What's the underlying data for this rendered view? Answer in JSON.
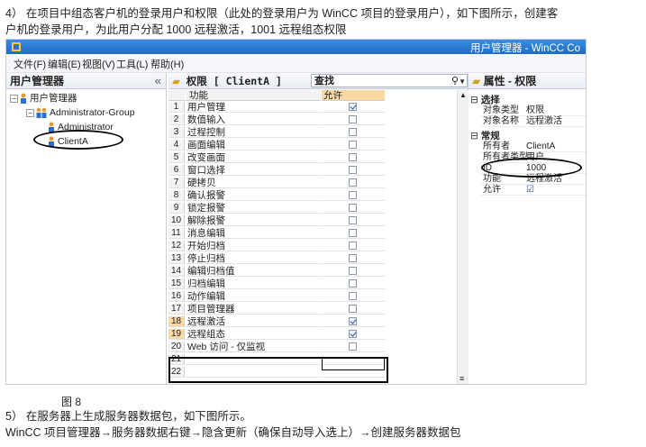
{
  "intro_line1": "4） 在项目中组态客户机的登录用户和权限（此处的登录用户为 WinCC 项目的登录用户），如下图所示，创建客",
  "intro_line2": "户机的登录用户，为此用户分配 1000 远程激活，1001 远程组态权限",
  "window": {
    "title": "用户管理器 - WinCC Co",
    "menu": [
      "文件(F)",
      "编辑(E)",
      "视图(V)",
      "工具(L)",
      "帮助(H)"
    ]
  },
  "left_pane": {
    "title": "用户管理器",
    "collapse_glyph": "«",
    "tree": {
      "root": "用户管理器",
      "group": "Administrator-Group",
      "users": [
        "Administrator",
        "ClientA"
      ]
    }
  },
  "middle_pane": {
    "title": "权限 [ ClientA ]",
    "search_placeholder": "查找",
    "columns": {
      "function": "功能",
      "allow": "允许"
    },
    "rows": [
      {
        "n": "1",
        "func": "用户管理",
        "checked": true
      },
      {
        "n": "2",
        "func": "数值输入",
        "checked": false
      },
      {
        "n": "3",
        "func": "过程控制",
        "checked": false
      },
      {
        "n": "4",
        "func": "画面编辑",
        "checked": false
      },
      {
        "n": "5",
        "func": "改变画面",
        "checked": false
      },
      {
        "n": "6",
        "func": "窗口选择",
        "checked": false
      },
      {
        "n": "7",
        "func": "硬拷贝",
        "checked": false
      },
      {
        "n": "8",
        "func": "确认报警",
        "checked": false
      },
      {
        "n": "9",
        "func": "锁定报警",
        "checked": false
      },
      {
        "n": "10",
        "func": "解除报警",
        "checked": false
      },
      {
        "n": "11",
        "func": "消息编辑",
        "checked": false
      },
      {
        "n": "12",
        "func": "开始归档",
        "checked": false
      },
      {
        "n": "13",
        "func": "停止归档",
        "checked": false
      },
      {
        "n": "14",
        "func": "编辑归档值",
        "checked": false
      },
      {
        "n": "15",
        "func": "归档编辑",
        "checked": false
      },
      {
        "n": "16",
        "func": "动作编辑",
        "checked": false
      },
      {
        "n": "17",
        "func": "项目管理器",
        "checked": false
      },
      {
        "n": "18",
        "func": "远程激活",
        "checked": true
      },
      {
        "n": "19",
        "func": "远程组态",
        "checked": true
      },
      {
        "n": "20",
        "func": "Web 访问 - 仅监视",
        "checked": false
      },
      {
        "n": "21",
        "func": "",
        "checked": null
      },
      {
        "n": "22",
        "func": "",
        "checked": null
      }
    ]
  },
  "right_pane": {
    "title": "属性 - 权限",
    "sections": [
      {
        "name": "选择",
        "props": [
          [
            "对象类型",
            "权限"
          ],
          [
            "对象名称",
            "远程激活"
          ]
        ]
      },
      {
        "name": "常规",
        "props": [
          [
            "所有者",
            "ClientA"
          ],
          [
            "所有者类型",
            "用户"
          ],
          [
            "ID",
            "1000"
          ],
          [
            "功能",
            "远程激活"
          ],
          [
            "允许",
            "☑"
          ]
        ]
      }
    ]
  },
  "figure_caption": "图 8",
  "step5": "5） 在服务器上生成服务器数据包，如下图所示。",
  "step5_path": "WinCC 项目管理器→服务器数据右键→隐含更新（确保自动导入选上）→创建服务器数据包",
  "colors": {
    "accent": "#1d6cc4",
    "highlight_row": "#f9d8a3"
  }
}
